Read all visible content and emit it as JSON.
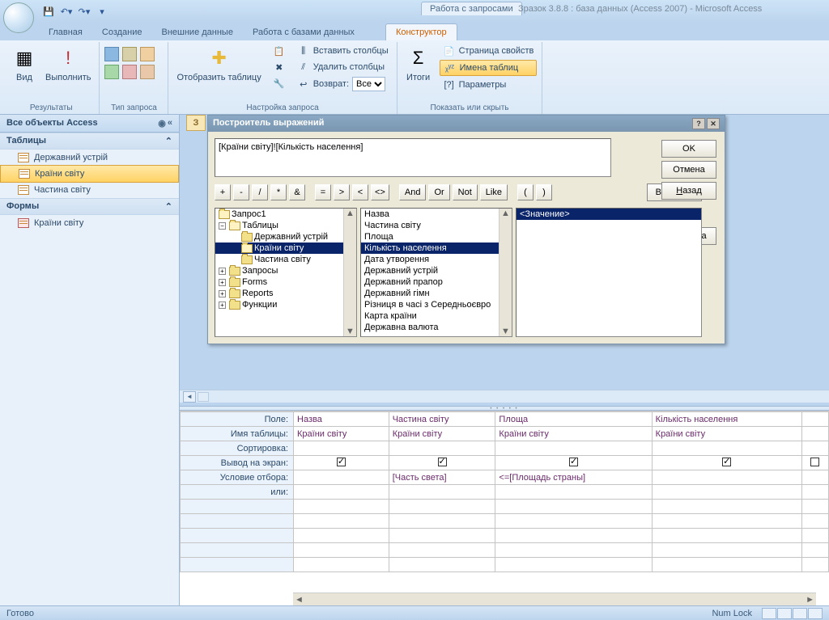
{
  "title": {
    "context": "Работа с запросами",
    "main": "Зразок 3.8.8 : база данных (Access 2007) - Microsoft Access"
  },
  "tabs": {
    "t0": "Главная",
    "t1": "Создание",
    "t2": "Внешние данные",
    "t3": "Работа с базами данных",
    "t4": "Конструктор"
  },
  "ribbon": {
    "results_label": "Результаты",
    "view": "Вид",
    "run": "Выполнить",
    "qtype_label": "Тип запроса",
    "show_table": "Отобразить таблицу",
    "setup_label": "Настройка запроса",
    "ins_cols": "Вставить столбцы",
    "del_cols": "Удалить столбцы",
    "return": "Возврат:",
    "return_val": "Все",
    "totals": "Итоги",
    "show_hide_label": "Показать или скрыть",
    "prop_page": "Страница свойств",
    "table_names": "Имена таблиц",
    "params": "Параметры"
  },
  "nav": {
    "header": "Все объекты Access",
    "tables_hdr": "Таблицы",
    "forms_hdr": "Формы",
    "tables": [
      "Державний устрій",
      "Країни світу",
      "Частина світу"
    ],
    "forms": [
      "Країни світу"
    ],
    "selected_table": "Країни світу"
  },
  "doc_tab": "З",
  "dialog": {
    "title": "Построитель выражений",
    "expression": "[Країни світу]![Кількість населення]",
    "ok": "OK",
    "cancel": "Отмена",
    "back": "Назад",
    "insert": "Вставить",
    "help": "Справка",
    "ops": [
      "+",
      "-",
      "/",
      "*",
      "&",
      "=",
      ">",
      "<",
      "<>",
      "And",
      "Or",
      "Not",
      "Like",
      "(",
      ")"
    ],
    "tree": {
      "root": "Запрос1",
      "tables": "Таблицы",
      "t0": "Державний устрій",
      "t1": "Країни світу",
      "t2": "Частина світу",
      "queries": "Запросы",
      "forms": "Forms",
      "reports": "Reports",
      "funcs": "Функции"
    },
    "fields": [
      "Назва",
      "Частина світу",
      "Площа",
      "Кількість населення",
      "Дата утворення",
      "Державний устрій",
      "Державний прапор",
      "Державний гімн",
      "Різниця в часі з Середньоєвро",
      "Карта країни",
      "Державна валюта"
    ],
    "selected_field": "Кількість населення",
    "value_placeholder": "<Значение>"
  },
  "grid": {
    "rows": {
      "field": "Поле:",
      "table": "Имя таблицы:",
      "sort": "Сортировка:",
      "show": "Вывод на экран:",
      "criteria": "Условие отбора:",
      "or": "или:"
    },
    "cols": [
      {
        "field": "Назва",
        "table": "Країни світу",
        "show": true,
        "crit": ""
      },
      {
        "field": "Частина світу",
        "table": "Країни світу",
        "show": true,
        "crit": "[Часть света]"
      },
      {
        "field": "Площа",
        "table": "Країни світу",
        "show": true,
        "crit": "<=[Площадь страны]"
      },
      {
        "field": "Кількість населення",
        "table": "Країни світу",
        "show": true,
        "crit": ""
      },
      {
        "field": "",
        "table": "",
        "show": false,
        "crit": ""
      }
    ]
  },
  "status": {
    "ready": "Готово",
    "numlock": "Num Lock"
  }
}
